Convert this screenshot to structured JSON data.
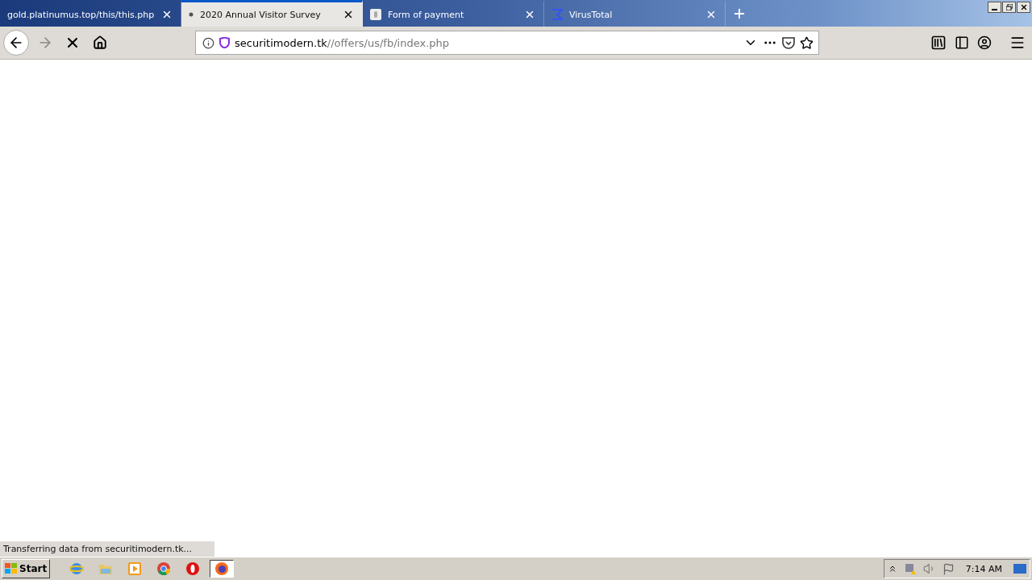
{
  "tabs": [
    {
      "title": "gold.platinumus.top/this/this.php",
      "kind": "plain",
      "selected": false
    },
    {
      "title": "2020 Annual Visitor Survey",
      "kind": "loading",
      "selected": true
    },
    {
      "title": "Form of payment",
      "kind": "page",
      "selected": false
    },
    {
      "title": "VirusTotal",
      "kind": "sigma",
      "selected": false
    }
  ],
  "toolbar": {
    "forward_disabled": true,
    "loading": true
  },
  "address": {
    "domain": "securitimodern.tk",
    "path": "//offers/us/fb/index.php"
  },
  "status": "Transferring data from securitimodern.tk...",
  "taskbar": {
    "start": "Start",
    "apps": [
      {
        "kind": "ie",
        "selected": false
      },
      {
        "kind": "folder",
        "selected": false
      },
      {
        "kind": "media",
        "selected": false
      },
      {
        "kind": "chrome",
        "selected": false
      },
      {
        "kind": "opera",
        "selected": false
      },
      {
        "kind": "firefox",
        "selected": true
      }
    ],
    "clock": "7:14 AM"
  }
}
